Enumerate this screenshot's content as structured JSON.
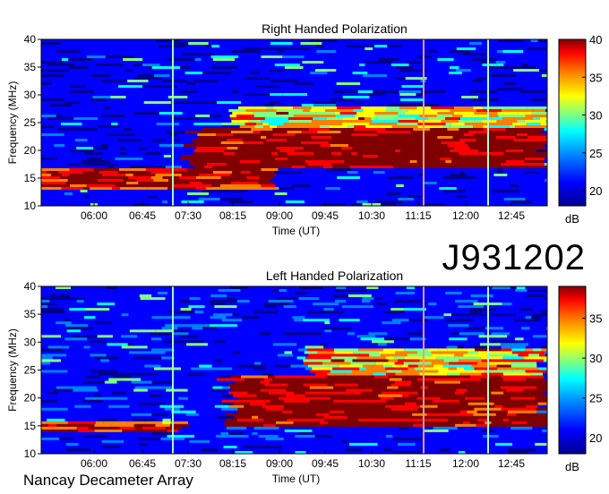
{
  "observation_id": "J931202",
  "observatory_label": "Nancay Decameter Array",
  "chart_data": [
    {
      "type": "heatmap",
      "title": "Right Handed Polarization",
      "xlabel": "Time (UT)",
      "ylabel": "Frequency (MHz)",
      "x_tick_labels": [
        "06:00",
        "06:45",
        "07:30",
        "08:15",
        "09:00",
        "09:45",
        "10:30",
        "11:15",
        "12:00",
        "12:45"
      ],
      "y_tick_labels": [
        "10",
        "15",
        "20",
        "25",
        "30",
        "35",
        "40"
      ],
      "ylim": [
        10,
        40
      ],
      "colorbar": {
        "unit": "dB",
        "ticks": [
          "20",
          "25",
          "30",
          "35",
          "40"
        ],
        "range": [
          18,
          40
        ]
      },
      "colormap": [
        "#00008f",
        "#0000ff",
        "#0080ff",
        "#00ffff",
        "#80ff80",
        "#ffff00",
        "#ff8000",
        "#ff0000",
        "#800000"
      ],
      "emission_summary": [
        {
          "freq_mhz": [
            17,
            24
          ],
          "time_ut": [
            "07:40",
            "13:10"
          ],
          "level_db": 38
        },
        {
          "freq_mhz": [
            24,
            28
          ],
          "time_ut": [
            "08:15",
            "13:10"
          ],
          "level_db": 30
        },
        {
          "freq_mhz": [
            13,
            17
          ],
          "time_ut": [
            "05:20",
            "09:00"
          ],
          "level_db": 36
        }
      ]
    },
    {
      "type": "heatmap",
      "title": "Left Handed Polarization",
      "xlabel": "Time (UT)",
      "ylabel": "Frequency (MHz)",
      "x_tick_labels": [
        "06:00",
        "06:45",
        "07:30",
        "08:15",
        "09:00",
        "09:45",
        "10:30",
        "11:15",
        "12:00",
        "12:45"
      ],
      "y_tick_labels": [
        "10",
        "15",
        "20",
        "25",
        "30",
        "35",
        "40"
      ],
      "ylim": [
        10,
        40
      ],
      "colorbar": {
        "unit": "dB",
        "ticks": [
          "20",
          "25",
          "30",
          "35"
        ],
        "range": [
          18,
          39
        ]
      },
      "colormap": [
        "#00008f",
        "#0000ff",
        "#0080ff",
        "#00ffff",
        "#80ff80",
        "#ffff00",
        "#ff8000",
        "#ff0000",
        "#800000"
      ],
      "emission_summary": [
        {
          "freq_mhz": [
            15,
            24
          ],
          "time_ut": [
            "08:15",
            "13:10"
          ],
          "level_db": 37
        },
        {
          "freq_mhz": [
            24,
            29
          ],
          "time_ut": [
            "09:30",
            "13:10"
          ],
          "level_db": 30
        },
        {
          "freq_mhz": [
            14,
            16
          ],
          "time_ut": [
            "05:20",
            "07:30"
          ],
          "level_db": 34
        }
      ]
    }
  ]
}
